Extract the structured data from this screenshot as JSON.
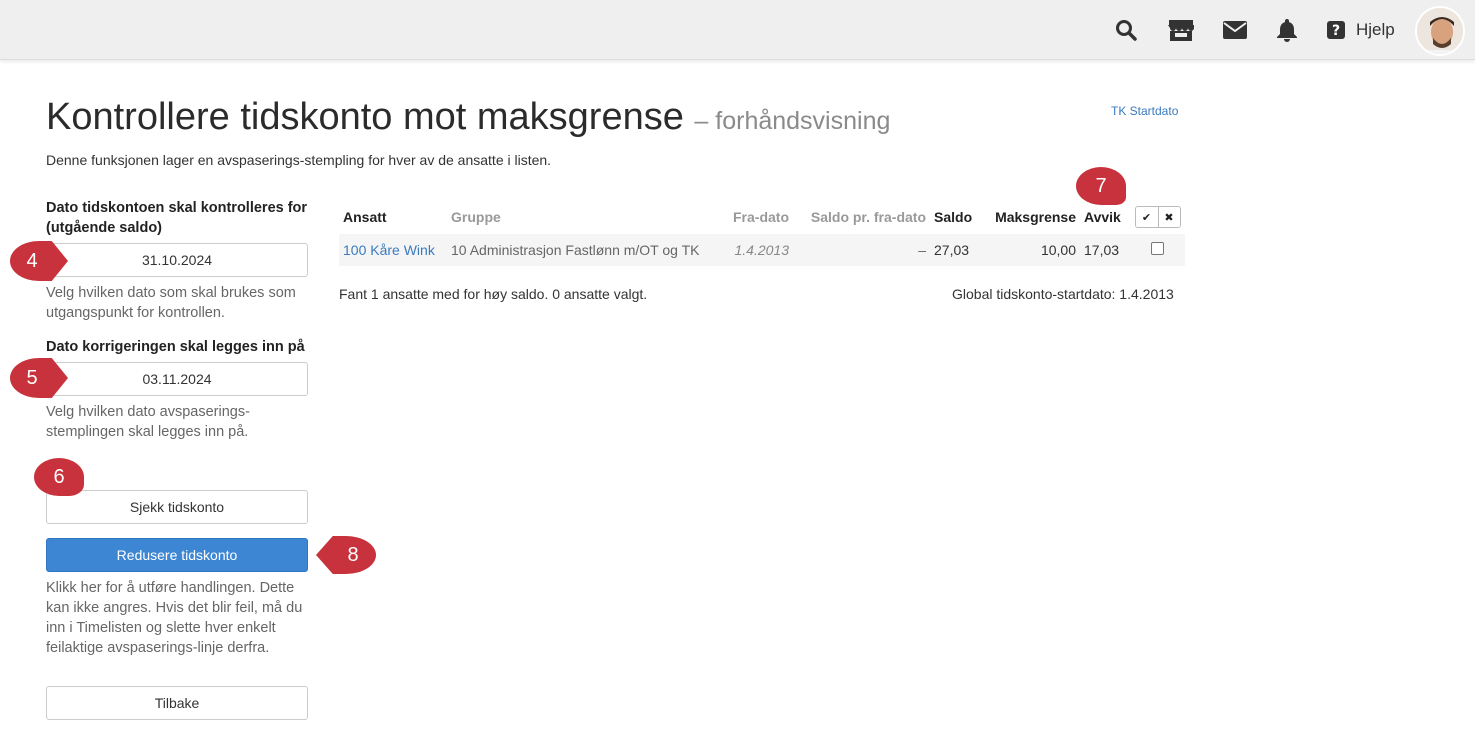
{
  "topbar": {
    "icons": [
      "search-icon",
      "store-icon",
      "mail-icon",
      "bell-icon",
      "help-icon"
    ],
    "help_label": "Hjelp"
  },
  "page": {
    "title": "Kontrollere tidskonto mot maksgrense",
    "subtitle": "– forhåndsvisning",
    "tk_link": "TK Startdato",
    "intro": "Denne funksjonen lager en avspaserings-stempling for hver av de ansatte i listen."
  },
  "form": {
    "check_date_label": "Dato tidskontoen skal kontrolleres for (utgående saldo)",
    "check_date_value": "31.10.2024",
    "check_date_help": "Velg hvilken dato som skal brukes som utgangspunkt for kontrollen.",
    "correction_date_label": "Dato korrigeringen skal legges inn på",
    "correction_date_value": "03.11.2024",
    "correction_date_help": "Velg hvilken dato avspaserings-stemplingen skal legges inn på.",
    "check_button": "Sjekk tidskonto",
    "reduce_button": "Redusere tidskonto",
    "reduce_help": "Klikk her for å utføre handlingen. Dette kan ikke angres. Hvis det blir feil, må du inn i Timelisten og slette hver enkelt feilaktige avspaserings-linje derfra.",
    "back_button": "Tilbake"
  },
  "markers": [
    "4",
    "5",
    "6",
    "7",
    "8"
  ],
  "table": {
    "headers": [
      "Ansatt",
      "Gruppe",
      "Fra-dato",
      "Saldo pr. fra-dato",
      "Saldo",
      "Maksgrense",
      "Avvik"
    ],
    "rows": [
      {
        "ansatt": "100 Kåre Wink",
        "gruppe": "10 Administrasjon Fastlønn m/OT og TK",
        "fra_dato": "1.4.2013",
        "saldo_fra": "–",
        "saldo": "27,03",
        "maks": "10,00",
        "avvik": "17,03",
        "checked": false
      }
    ]
  },
  "result_text": "Fant 1 ansatte med for høy saldo. 0 ansatte valgt.",
  "global_text": "Global tidskonto-startdato: 1.4.2013",
  "colors": {
    "primary": "#3d86d4",
    "marker": "#c8323c",
    "link": "#3a7abf"
  }
}
